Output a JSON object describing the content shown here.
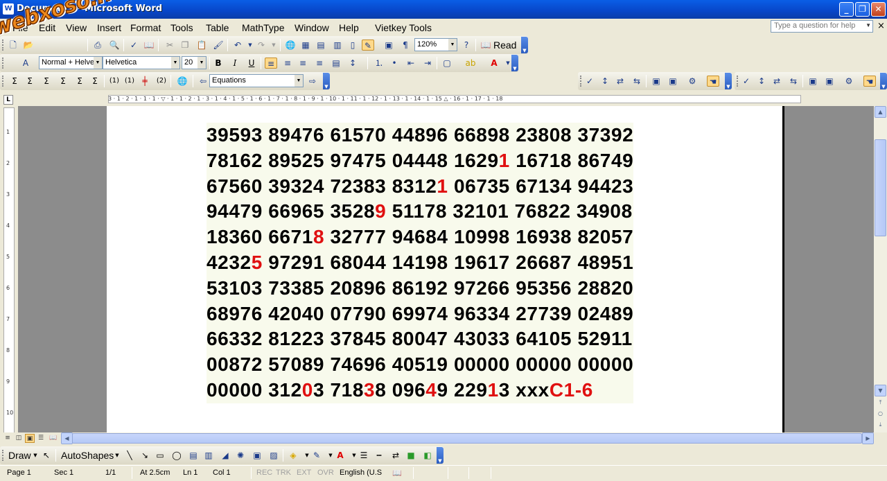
{
  "window": {
    "app_icon": "W",
    "title": "Document1 - Microsoft Word",
    "controls": {
      "minimize": "_",
      "restore": "❐",
      "close": "✕"
    }
  },
  "menu": {
    "items": [
      "File",
      "Edit",
      "View",
      "Insert",
      "Format",
      "Tools",
      "Table",
      "MathType",
      "Window",
      "Help",
      "Vietkey Tools"
    ],
    "help_placeholder": "Type a question for help",
    "doc_close": "×"
  },
  "standard_toolbar": {
    "zoom": "120%",
    "read_label": "Read"
  },
  "formatting_toolbar": {
    "style": "Normal + Helve",
    "font": "Helvetica",
    "size": "20",
    "bold": "B",
    "italic": "I",
    "underline": "U"
  },
  "mathtype_toolbar": {
    "equations_combo": "Equations"
  },
  "ruler": {
    "h_ticks": "3 · 1 · 2 · 1 · 1 · 1 · ▽ · 1 · 1 · 2 · 1 · 3 · 1 · 4 · 1 · 5 · 1 · 6 · 1 · 7 · 1 · 8 · 1 · 9 · 1 · 10 · 1 · 11 · 1 · 12 · 1 · 13 · 1 · 14 · 1 · 15 △ · 16 · 1 · 17 · 1 · 18",
    "v_ticks": [
      "1",
      "2",
      "3",
      "4",
      "5",
      "6",
      "7",
      "8",
      "9",
      "10"
    ],
    "tab_corner": "L"
  },
  "document": {
    "rows": [
      [
        {
          "t": "39593 89476 61570 44896 66898 23808 37392",
          "r": ""
        }
      ],
      [
        {
          "t": "78162 89525 97475 04448 1629",
          "r": ""
        },
        {
          "t": "1",
          "r": "red"
        },
        {
          "t": " 16718 86749",
          "r": ""
        }
      ],
      [
        {
          "t": "67560 39324 72383 8312",
          "r": ""
        },
        {
          "t": "1",
          "r": "red"
        },
        {
          "t": " 06735 67134 94423",
          "r": ""
        }
      ],
      [
        {
          "t": "94479 66965 3528",
          "r": ""
        },
        {
          "t": "9",
          "r": "red"
        },
        {
          "t": " 51178 32101 76822 34908",
          "r": ""
        }
      ],
      [
        {
          "t": "18360 6671",
          "r": ""
        },
        {
          "t": "8",
          "r": "red"
        },
        {
          "t": " 32777 94684 10998 16938 82057",
          "r": ""
        }
      ],
      [
        {
          "t": "4232",
          "r": ""
        },
        {
          "t": "5",
          "r": "red"
        },
        {
          "t": " 97291 68044 14198 19617 26687 48951",
          "r": ""
        }
      ],
      [
        {
          "t": "53103 73385 20896 86192 97266 95356 28820",
          "r": ""
        }
      ],
      [
        {
          "t": "68976 42040 07790 69974 96334 27739 02489",
          "r": ""
        }
      ],
      [
        {
          "t": "66332 81223 37845 80047 43033 64105 52911",
          "r": ""
        }
      ],
      [
        {
          "t": "00872 57089 74696 40519 00000 00000 00000",
          "r": ""
        }
      ],
      [
        {
          "t": "00000 312",
          "r": ""
        },
        {
          "t": "0",
          "r": "red"
        },
        {
          "t": "3 718",
          "r": ""
        },
        {
          "t": "3",
          "r": "red"
        },
        {
          "t": "8 096",
          "r": ""
        },
        {
          "t": "4",
          "r": "red"
        },
        {
          "t": "9 229",
          "r": ""
        },
        {
          "t": "1",
          "r": "red"
        },
        {
          "t": "3 xxx",
          "r": ""
        },
        {
          "t": "C1-6",
          "r": "red"
        }
      ]
    ],
    "colors": {
      "text": "#000000",
      "highlight": "#e01010",
      "cell_bg": "#f8faec"
    }
  },
  "drawing_toolbar": {
    "draw_label": "Draw",
    "autoshapes_label": "AutoShapes"
  },
  "status": {
    "page": "Page 1",
    "sec": "Sec 1",
    "pages": "1/1",
    "at": "At 2.5cm",
    "ln": "Ln 1",
    "col": "Col 1",
    "rec": "REC",
    "trk": "TRK",
    "ext": "EXT",
    "ovr": "OVR",
    "lang": "English (U.S"
  },
  "watermark": "webxoso.net"
}
